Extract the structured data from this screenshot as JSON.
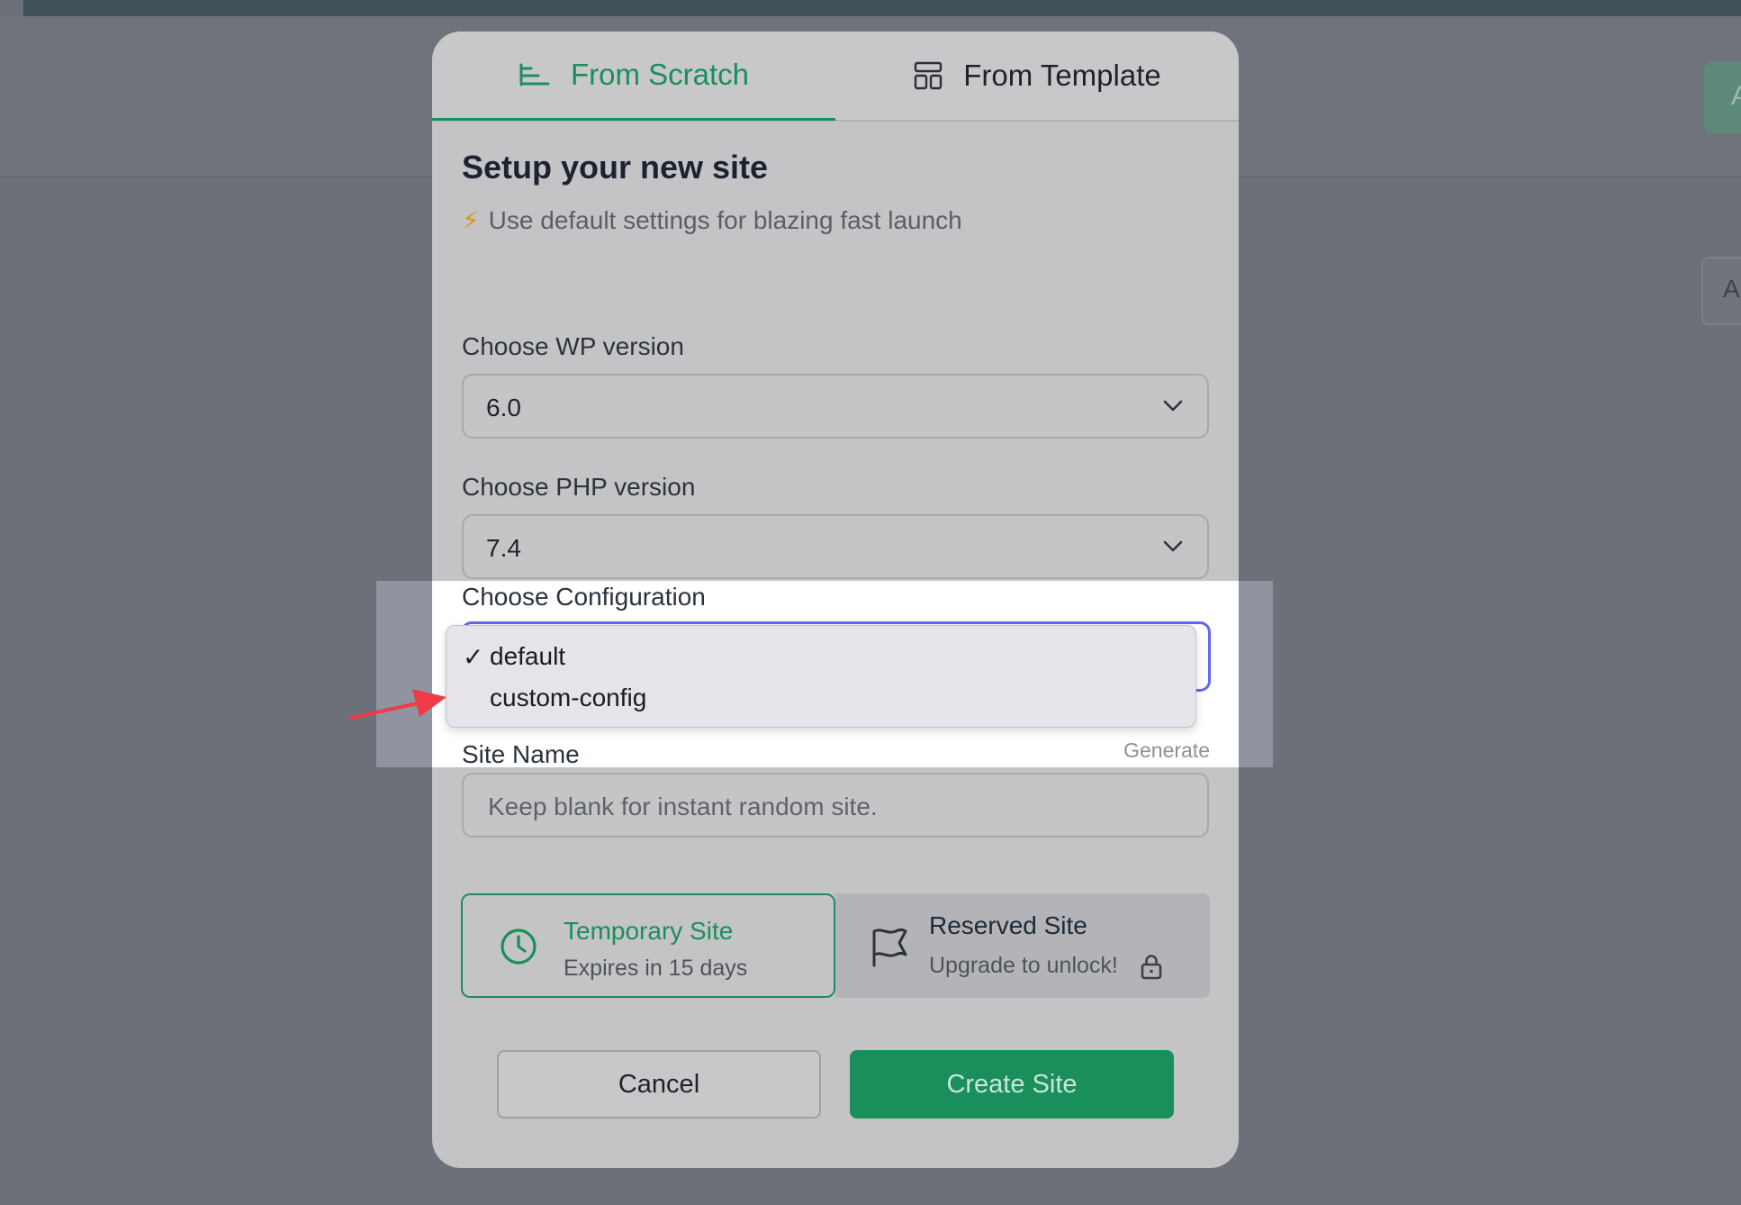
{
  "tabs": {
    "from_scratch": "From Scratch",
    "from_template": "From Template"
  },
  "setup": {
    "title": "Setup your new site",
    "subtitle": "Use default settings for blazing fast launch"
  },
  "wp_version": {
    "label": "Choose WP version",
    "value": "6.0"
  },
  "php_version": {
    "label": "Choose PHP version",
    "value": "7.4"
  },
  "configuration": {
    "label": "Choose Configuration",
    "options": [
      "default",
      "custom-config"
    ],
    "selected": "default"
  },
  "site_name": {
    "label": "Site Name",
    "generate": "Generate",
    "placeholder": "Keep blank for instant random site."
  },
  "site_types": {
    "temporary": {
      "title": "Temporary Site",
      "subtitle": "Expires in 15 days"
    },
    "reserved": {
      "title": "Reserved Site",
      "subtitle": "Upgrade to unlock!"
    }
  },
  "buttons": {
    "cancel": "Cancel",
    "create": "Create Site"
  },
  "background": {
    "button_letter": "A",
    "chip_letter": "A"
  },
  "colors": {
    "accent_green": "#1a8f5c",
    "focus_ring": "#6366f1",
    "annotation_arrow": "#ef3b4a"
  }
}
